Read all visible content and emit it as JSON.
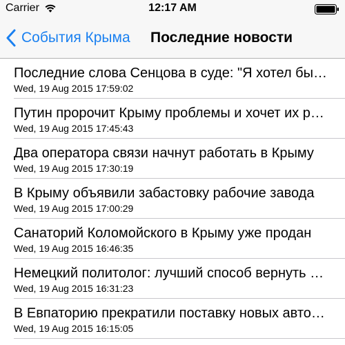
{
  "status_bar": {
    "carrier": "Carrier",
    "time": "12:17 AM",
    "wifi_icon": "wifi-icon",
    "battery_icon": "battery-full-icon"
  },
  "nav_bar": {
    "back_label": "События Крыма",
    "back_icon": "chevron-left-icon",
    "title": "Последние новости",
    "accent_color": "#1a80f0"
  },
  "news": [
    {
      "title": "Последние слова Сенцова в суде: \"Я хотел бы сказать...\"",
      "date": "Wed, 19 Aug 2015 17:59:02"
    },
    {
      "title": "Путин пророчит Крыму проблемы и хочет их решить",
      "date": "Wed, 19 Aug 2015 17:45:43"
    },
    {
      "title": "Два оператора связи начнут работать в Крыму",
      "date": "Wed, 19 Aug 2015 17:30:19"
    },
    {
      "title": "В Крыму объявили забастовку рабочие завода",
      "date": "Wed, 19 Aug 2015 17:00:29"
    },
    {
      "title": "Санаторий Коломойского в Крыму уже продан",
      "date": "Wed, 19 Aug 2015 16:46:35"
    },
    {
      "title": "Немецкий политолог: лучший способ вернуть Крым",
      "date": "Wed, 19 Aug 2015 16:31:23"
    },
    {
      "title": "В Евпаторию прекратили поставку новых автобусов",
      "date": "Wed, 19 Aug 2015 16:15:05"
    }
  ]
}
